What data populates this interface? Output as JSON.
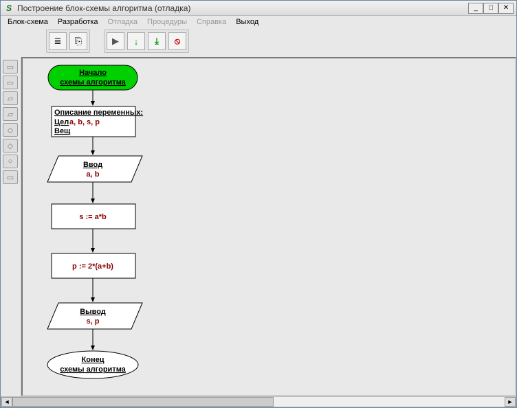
{
  "window": {
    "title": "Построение блок-схемы алгоритма (отладка)"
  },
  "menu": {
    "item1": "Блок-схема",
    "item2": "Разработка",
    "item3": "Отладка",
    "item4": "Процедуры",
    "item5": "Справка",
    "item6": "Выход"
  },
  "toolbar": {
    "left1": "≣",
    "left2": "⎘",
    "play": "▶",
    "step_over": "↓",
    "step_into": "⤓",
    "stop": "⦸"
  },
  "palette": {
    "p1": "▭",
    "p2": "▭",
    "p3": "▱",
    "p4": "▱",
    "p5": "◇",
    "p6": "◇",
    "p7": "○",
    "p8": "▭"
  },
  "flowchart": {
    "start": {
      "line1": "Начало",
      "line2": "схемы алгоритма"
    },
    "vars": {
      "title": "Описание переменных:",
      "int_label": "Цел",
      "int_list": " a, b, s, p",
      "real_label": "Вещ"
    },
    "input": {
      "label": "Ввод",
      "vars": "a, b"
    },
    "proc1": {
      "expr": "s := a*b"
    },
    "proc2": {
      "expr": "p := 2*(a+b)"
    },
    "output": {
      "label": "Вывод",
      "vars": "s, p"
    },
    "end": {
      "line1": "Конец",
      "line2": "схемы алгоритма"
    }
  }
}
